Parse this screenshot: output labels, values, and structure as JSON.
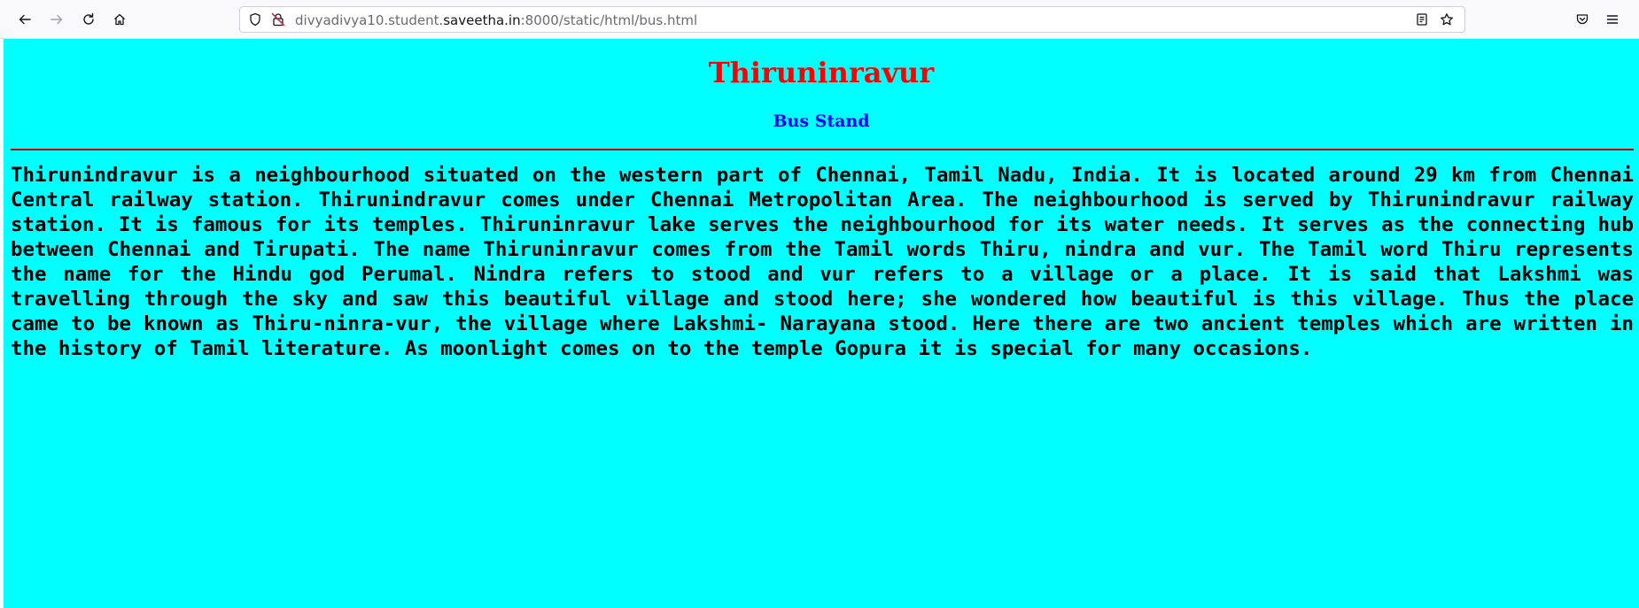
{
  "browser": {
    "url": {
      "prefix": "divyadivya10.student.",
      "domain": "saveetha.in",
      "suffix": ":8000/static/html/bus.html"
    },
    "icons": {
      "back": "back-arrow-icon",
      "forward": "forward-arrow-icon",
      "reload": "reload-icon",
      "home": "home-icon",
      "shield": "shield-icon",
      "insecure": "insecure-lock-icon",
      "reader": "reader-view-icon",
      "bookmark": "star-icon",
      "pocket": "pocket-icon",
      "menu": "hamburger-menu-icon"
    }
  },
  "page": {
    "background": "#00ffff",
    "title": "Thiruninravur",
    "title_color": "#ff0000",
    "subtitle": "Bus Stand",
    "subtitle_color": "#0000ff",
    "rule_color": "#cc0000",
    "paragraph": "Thirunindravur is a neighbourhood situated on the western part of Chennai, Tamil Nadu, India. It is located around 29 km from Chennai Central railway station. Thirunindravur comes under Chennai Metropolitan Area. The neighbourhood is served by Thirunindravur railway station. It is famous for its temples. Thiruninravur lake serves the neighbourhood for its water needs. It serves as the connecting hub between Chennai and Tirupati. The name Thiruninravur comes from the Tamil words Thiru, nindra and vur. The Tamil word Thiru represents the name for the Hindu god Perumal. Nindra refers to stood and vur refers to a village or a place. It is said that Lakshmi was travelling through the sky and saw this beautiful village and stood here; she wondered how beautiful is this village. Thus the place came to be known as Thiru-ninra-vur, the village where Lakshmi- Narayana stood. Here there are two ancient temples which are written in the history of Tamil literature. As moonlight comes on to the temple Gopura it is special for many occasions."
  }
}
